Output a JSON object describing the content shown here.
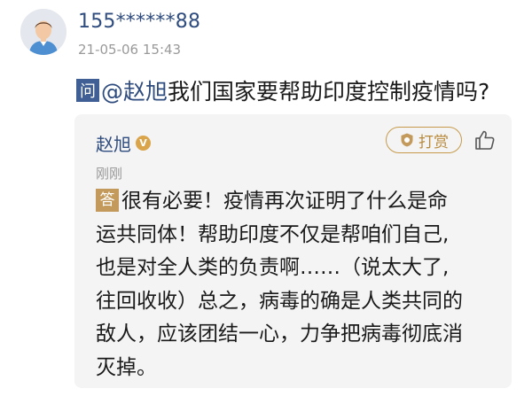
{
  "header": {
    "username": "155******88",
    "timestamp": "21-05-06 15:43"
  },
  "question": {
    "badge": "问",
    "mention": "@赵旭",
    "text": "我们国家要帮助印度控制疫情吗?"
  },
  "answer": {
    "author": "赵旭",
    "verified_badge": "V",
    "tip_label": "打赏",
    "time": "刚刚",
    "badge": "答",
    "lines": [
      "很有必要！疫情再次证明了什么是命",
      "运共同体！帮助印度不仅是帮咱们自己,",
      "也是对全人类的负责啊……（说太大了,",
      "往回收收）总之，病毒的确是人类共同的",
      "敌人，应该团结一心，力争把病毒彻底消",
      "灭掉。"
    ]
  },
  "colors": {
    "link_blue": "#2f4c7e",
    "question_badge": "#3f5f95",
    "answer_badge": "#c39a5c",
    "tip_gold": "#b98a3a",
    "card_background": "#f4f4f5",
    "meta_gray": "#9a9a9a"
  },
  "icons": {
    "avatar": "user-avatar-icon",
    "verified": "verified-v-icon",
    "tip": "coin-shield-icon",
    "like": "thumbs-up-icon"
  }
}
